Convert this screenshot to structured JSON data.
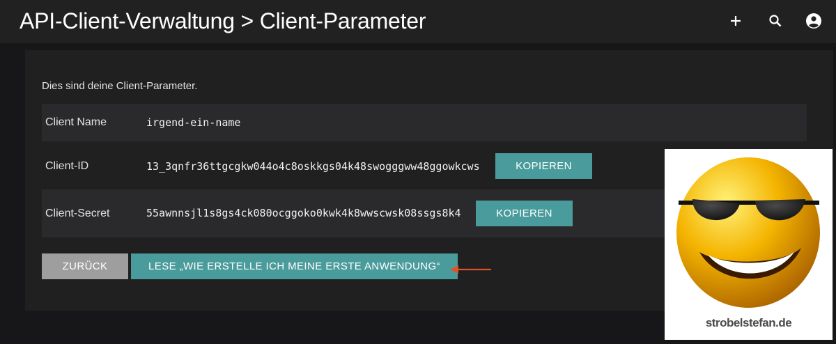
{
  "header": {
    "title": "API-Client-Verwaltung > Client-Parameter",
    "icons": [
      "add-icon",
      "search-icon",
      "account-icon"
    ]
  },
  "main": {
    "intro": "Dies sind deine Client-Parameter.",
    "rows": [
      {
        "label": "Client Name",
        "value": "irgend-ein-name"
      },
      {
        "label": "Client-ID",
        "value": "13_3qnfr36ttgcgkw044o4c8oskkgs04k48swogggww48ggowkcws",
        "button": "KOPIEREN"
      },
      {
        "label": "Client-Secret",
        "value": "55awnnsjl1s8gs4ck080ocggoko0kwk4k8wwscwsk08ssgs8k4",
        "button": "KOPIEREN"
      }
    ],
    "back_button": "ZURÜCK",
    "read_button": "LESE „WIE ERSTELLE ICH MEINE ERSTE ANWENDUNG“"
  },
  "watermark": {
    "text": "strobelstefan.de",
    "icon": "sunglasses-smiley-icon"
  },
  "colors": {
    "accent": "#4a9b9b",
    "back_button": "#9e9e9e",
    "arrow": "#e0522a",
    "background": "#171618",
    "card": "#202021"
  }
}
